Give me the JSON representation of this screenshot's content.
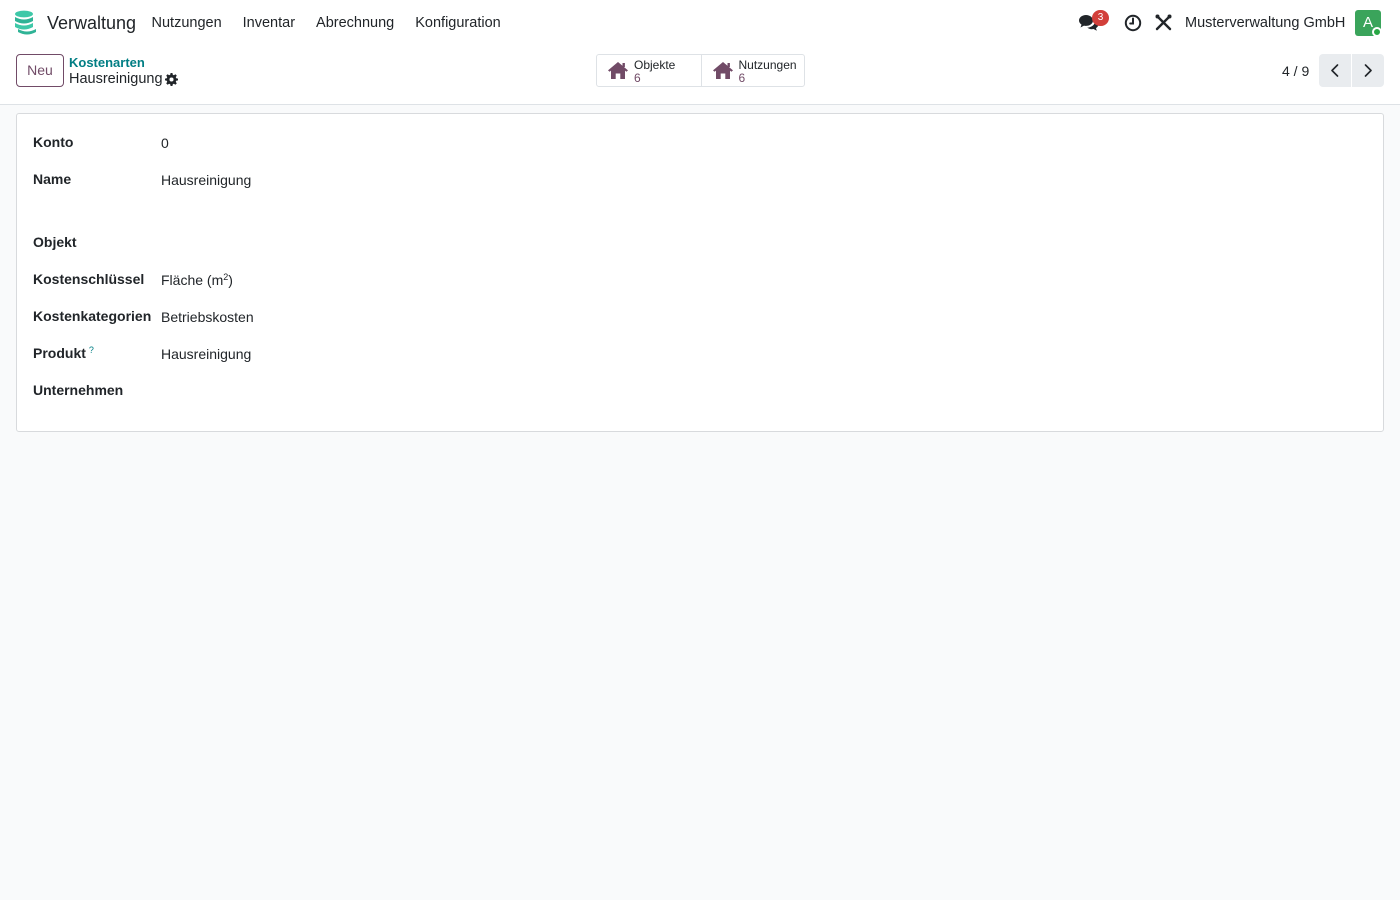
{
  "app": {
    "name": "Verwaltung",
    "logo_icon": "stacked-coins-icon",
    "brand_color": "#3ec8a8"
  },
  "menu": {
    "items": [
      {
        "label": "Nutzungen"
      },
      {
        "label": "Inventar"
      },
      {
        "label": "Abrechnung"
      },
      {
        "label": "Konfiguration"
      }
    ]
  },
  "systray": {
    "messages_badge": "3",
    "company": "Musterverwaltung GmbH",
    "avatar_initial": "A",
    "avatar_color": "#3aa45b",
    "badge_color": "#d23f3a"
  },
  "control_panel": {
    "new_label": "Neu",
    "breadcrumb_parent": "Kostenarten",
    "record_name": "Hausreinigung",
    "smart_buttons": [
      {
        "label": "Objekte",
        "value": "6",
        "icon": "house-icon"
      },
      {
        "label": "Nutzungen",
        "value": "6",
        "icon": "house-icon"
      }
    ],
    "pager": "4 / 9",
    "accent_color": "#714b67",
    "link_color": "#017e84"
  },
  "form": {
    "fields": {
      "konto": {
        "label": "Konto",
        "value": "0"
      },
      "name": {
        "label": "Name",
        "value": "Hausreinigung"
      },
      "objekt": {
        "label": "Objekt",
        "value": ""
      },
      "kostenschluessel": {
        "label": "Kostenschlüssel",
        "value_base": "Fläche (m",
        "value_sup": "2",
        "value_end": ")"
      },
      "kostenkategorien": {
        "label": "Kostenkategorien",
        "value": "Betriebskosten"
      },
      "produkt": {
        "label": "Produkt",
        "help": "?",
        "value": "Hausreinigung"
      },
      "unternehmen": {
        "label": "Unternehmen",
        "value": ""
      }
    }
  }
}
